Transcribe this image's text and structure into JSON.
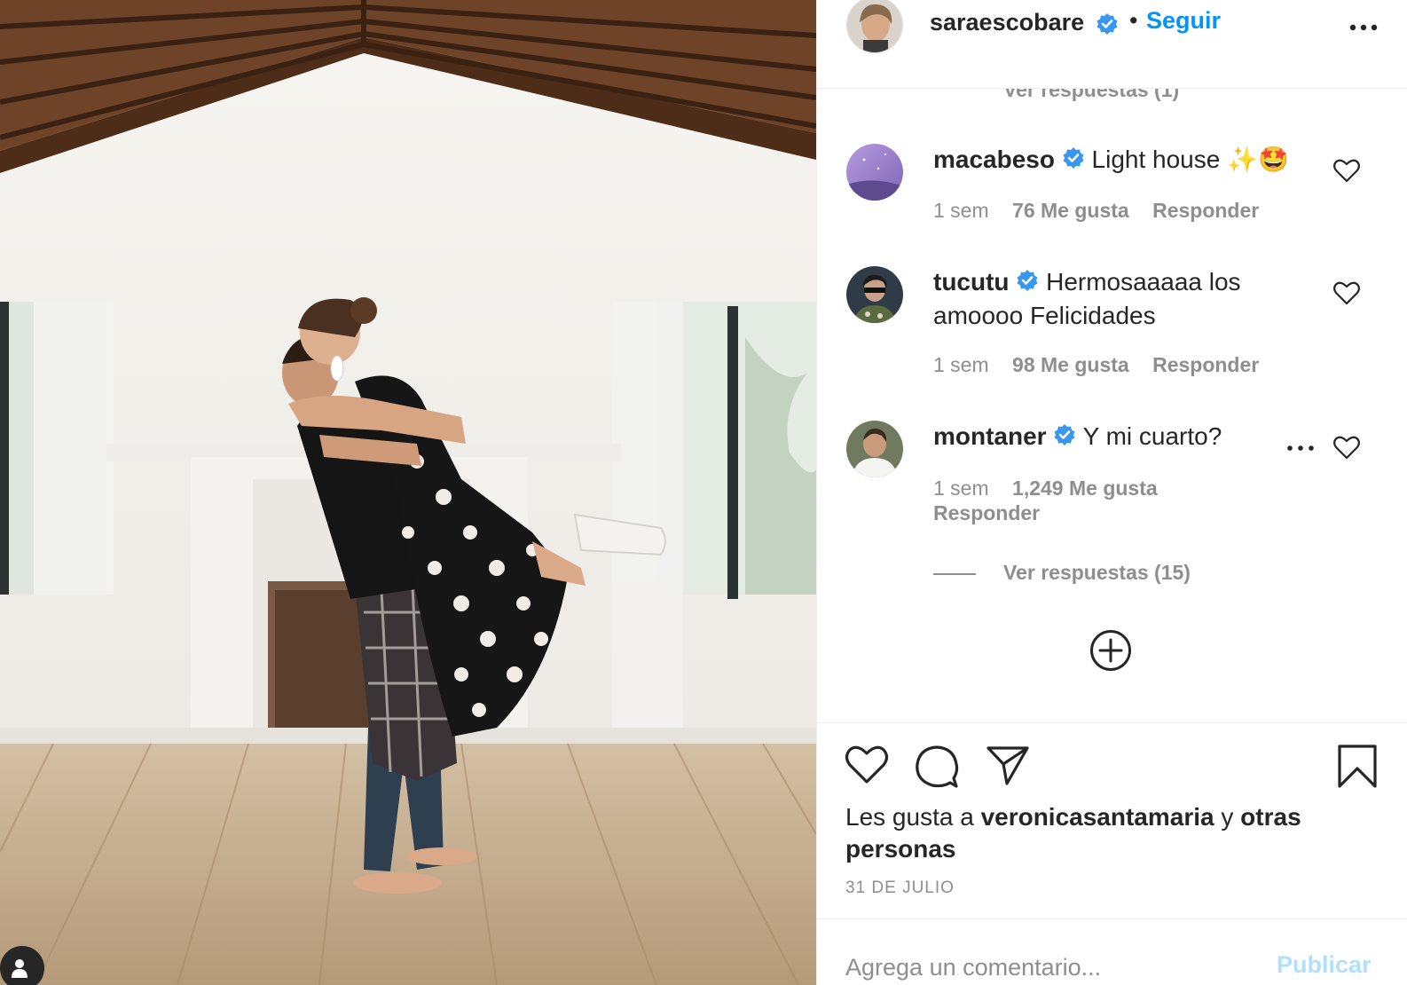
{
  "post": {
    "author": "saraescobare",
    "separator": "•",
    "follow_label": "Seguir",
    "image_alt": "Pareja abrazándose en una casa vacía de paredes blancas con techo de vigas de madera"
  },
  "comments_panel": {
    "prev_view_replies": "Ver respuestas (1)",
    "comments": [
      {
        "username": "macabeso",
        "text": "Light house ✨🤩",
        "time": "1 sem",
        "likes": "76 Me gusta",
        "reply_label": "Responder"
      },
      {
        "username": "tucutu",
        "text": "Hermosaaaaa los amoooo Felicidades",
        "time": "1 sem",
        "likes": "98 Me gusta",
        "reply_label": "Responder"
      },
      {
        "username": "montaner",
        "text": "Y mi cuarto?",
        "time": "1 sem",
        "likes": "1,249 Me gusta",
        "reply_label": "Responder"
      }
    ],
    "view_replies": "Ver respuestas (15)"
  },
  "likes": {
    "prefix": "Les gusta a",
    "user": "veronicasantamaria",
    "connector": "y",
    "others": "otras personas"
  },
  "date": "31 DE JULIO",
  "add_comment": {
    "placeholder": "Agrega un comentario...",
    "publish_label": "Publicar"
  },
  "colors": {
    "accent": "#0095f6",
    "verified": "#3897f0",
    "muted_text": "#8e8e8e",
    "primary_text": "#262626",
    "publish_disabled": "#b2dffc"
  },
  "icons": {
    "like": "heart-icon",
    "comment": "comment-icon",
    "share": "paper-plane-icon",
    "save": "bookmark-icon",
    "more": "more-options-icon",
    "load_more": "plus-circle-icon",
    "verified": "verified-badge-icon",
    "tag": "user-tag-icon"
  }
}
